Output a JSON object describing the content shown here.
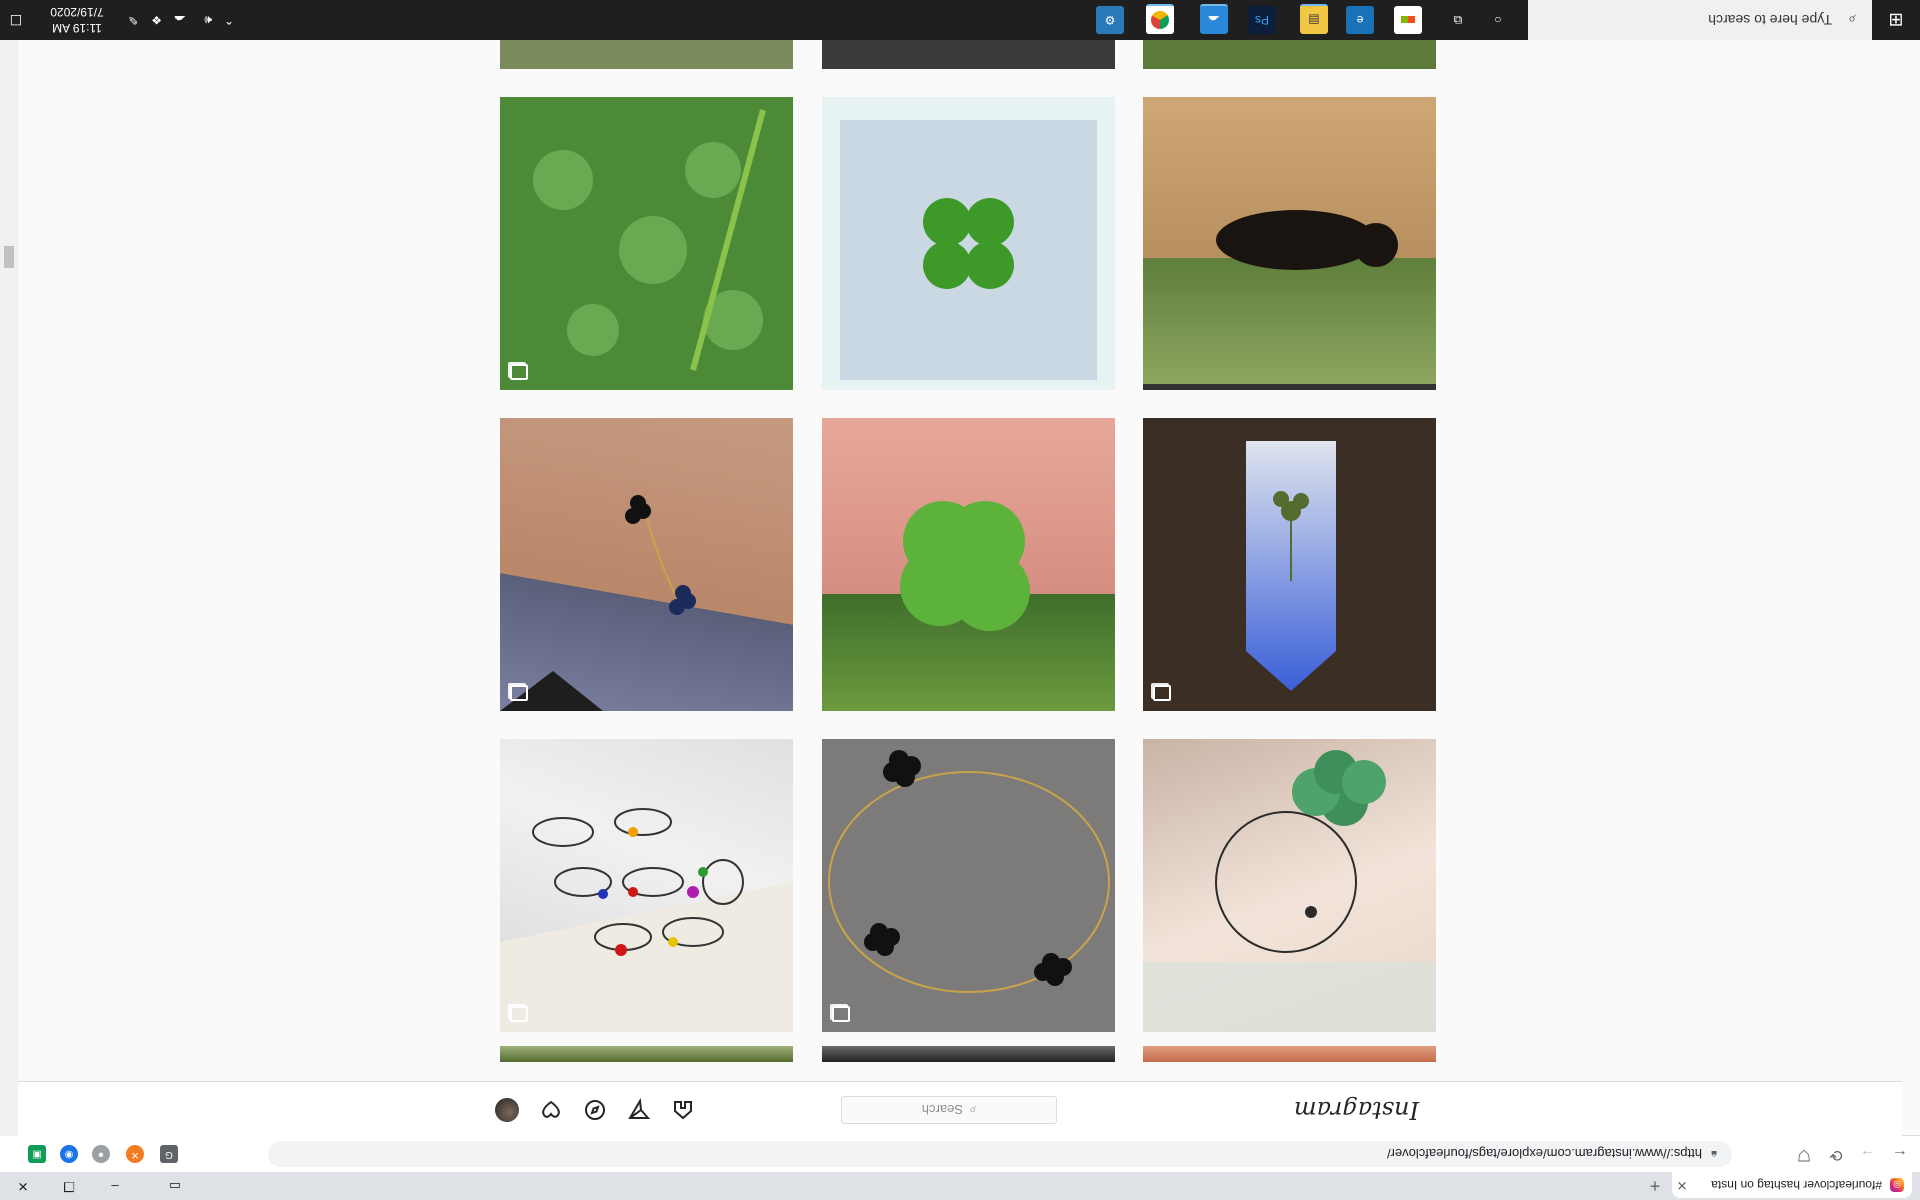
{
  "browser": {
    "tab_title": "#fourleafclover hashtag on Insta",
    "url": "https://www.instagram.com/explore/tags/fourleafclover/",
    "extension_avatar_letter": "Z"
  },
  "instagram": {
    "logo": "Instagram",
    "search_placeholder": "Search",
    "search_glyph": "⌕"
  },
  "posts": [
    {
      "id": 1,
      "subject": "bracelet-half",
      "multi": false
    },
    {
      "id": 2,
      "subject": "hand-half",
      "multi": false
    },
    {
      "id": 3,
      "subject": "plant-half",
      "multi": false
    },
    {
      "id": 4,
      "subject": "clover-tattoo",
      "multi": false
    },
    {
      "id": 5,
      "subject": "gold-clover-bracelet",
      "multi": true
    },
    {
      "id": 6,
      "subject": "colorful-rings",
      "multi": true
    },
    {
      "id": 7,
      "subject": "clover-pennant",
      "multi": true
    },
    {
      "id": 8,
      "subject": "four-leaf-clover-in-hand",
      "multi": false
    },
    {
      "id": 9,
      "subject": "clover-bracelet-on-wrist",
      "multi": true
    },
    {
      "id": 10,
      "subject": "cat-on-fence",
      "multi": false
    },
    {
      "id": 11,
      "subject": "clover-in-water",
      "multi": false
    },
    {
      "id": 12,
      "subject": "clover-patch",
      "multi": true
    }
  ],
  "taskbar": {
    "search_placeholder": "Type here to search",
    "time": "11:19 AM",
    "date": "7/19/2020"
  },
  "colors": {
    "page_bg": "#fafafa",
    "taskbar_bg": "#1f1f1f",
    "accent": "#76b9ed"
  }
}
